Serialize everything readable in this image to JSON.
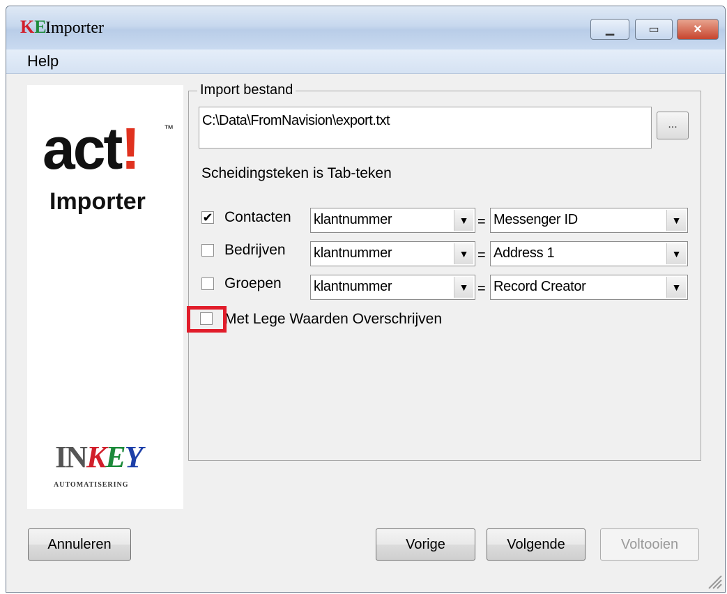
{
  "window": {
    "title": "Importer"
  },
  "menu": {
    "items": [
      "Help"
    ]
  },
  "logo": {
    "act_text": "act",
    "act_bang": "!",
    "act_tm": "™",
    "act_subtitle": "Importer",
    "inkey_in": "IN",
    "inkey_k": "K",
    "inkey_e": "E",
    "inkey_y": "Y",
    "inkey_subtitle": "AUTOMATISERING"
  },
  "import": {
    "group_label": "Import bestand",
    "file_path": "C:\\Data\\FromNavision\\export.txt",
    "browse_label": "...",
    "separator_text": "Scheidingsteken is Tab-teken"
  },
  "rows": [
    {
      "label": "Contacten",
      "checked": true,
      "left_value": "klantnummer",
      "right_value": "Messenger ID"
    },
    {
      "label": "Bedrijven",
      "checked": false,
      "left_value": "klantnummer",
      "right_value": "Address 1"
    },
    {
      "label": "Groepen",
      "checked": false,
      "left_value": "klantnummer",
      "right_value": "Record Creator"
    }
  ],
  "equals": "=",
  "overwrite": {
    "label": "Met Lege Waarden Overschrijven",
    "checked": false
  },
  "buttons": {
    "cancel": "Annuleren",
    "previous": "Vorige",
    "next": "Volgende",
    "finish": "Voltooien"
  },
  "colors": {
    "highlight": "#e11c2a",
    "act_bang": "#e0321f"
  }
}
